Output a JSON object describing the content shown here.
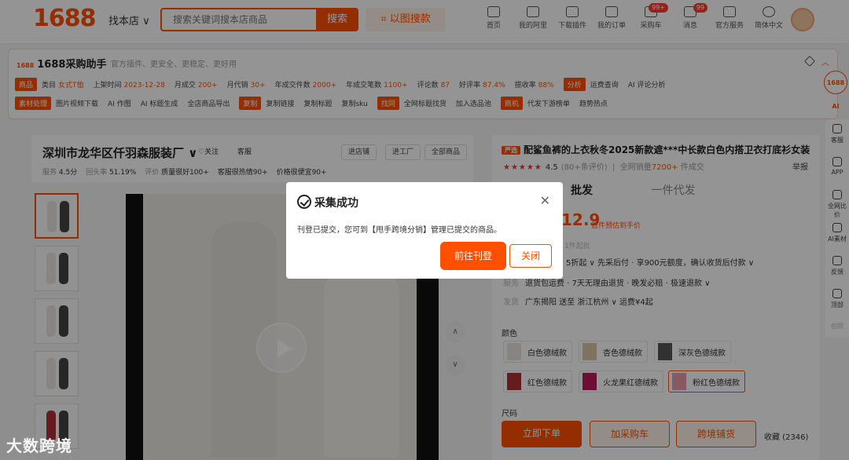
{
  "header": {
    "logo": "1688",
    "store_find": "找本店 ∨",
    "search_placeholder": "搜索关键词搜本店商品",
    "search_btn": "搜索",
    "image_search": "⌗ 以图搜款",
    "nav": [
      {
        "label": "首页"
      },
      {
        "label": "我的阿里"
      },
      {
        "label": "下载插件"
      },
      {
        "label": "我的订单"
      },
      {
        "label": "采购车",
        "badge": "99+"
      },
      {
        "label": "消息",
        "badge": "99"
      },
      {
        "label": "官方服务"
      },
      {
        "label": "简体中文"
      }
    ]
  },
  "helper": {
    "logo_mark": "1688",
    "title": "1688采购助手",
    "subtitle": "官方插件、更安全、更稳定、更好用",
    "row1": {
      "tag": "商品",
      "items": [
        {
          "label": "类目",
          "value": "女式T恤"
        },
        {
          "label": "上架时间",
          "value": "2023-12-28"
        },
        {
          "label": "月成交",
          "value": "200+"
        },
        {
          "label": "月代销",
          "value": "30+"
        },
        {
          "label": "年成交件数",
          "value": "2000+"
        },
        {
          "label": "年成交笔数",
          "value": "1100+"
        },
        {
          "label": "评论数",
          "value": "87"
        },
        {
          "label": "好评率",
          "value": "87.4%"
        },
        {
          "label": "揽收率",
          "value": "88%"
        }
      ],
      "tag2": "分析",
      "analysis": [
        "运费查询",
        "AI 评论分析"
      ]
    },
    "row2": {
      "tag": "素材处理",
      "items": [
        "图片视频下载",
        "AI 作图",
        "AI 标题生成",
        "全店商品导出"
      ],
      "tag_copy": "复制",
      "copy_items": [
        "复制链接",
        "复制标题",
        "复制sku"
      ],
      "tag_find": "找同",
      "find_items": [
        "全网标题找货",
        "加入选品池"
      ],
      "tag_biz": "商机",
      "biz_items": [
        "代发下游榜单",
        "趋势热点"
      ]
    }
  },
  "sidebar": {
    "ai_label": "1688 AI",
    "items": [
      "客服",
      "APP",
      "全网比价",
      "AI素材",
      "反馈",
      "顶部",
      "拍照"
    ]
  },
  "store": {
    "name": "深圳市龙华区仟羽森服装厂 ∨",
    "follow": "♡关注",
    "service": "客服",
    "buttons": [
      "进店铺",
      "进工厂",
      "全部商品"
    ],
    "stats": [
      {
        "label": "服务",
        "value": "4.5分"
      },
      {
        "label": "回头率",
        "value": "51.19%"
      },
      {
        "label": "评价",
        "value": "质量很好100+"
      },
      {
        "label": "",
        "value": "客服很热情90+"
      },
      {
        "label": "",
        "value": "价格很便宜90+"
      }
    ]
  },
  "product": {
    "badge": "严选",
    "title": "配鲨鱼裤的上衣秋冬2025新款遮***中长款白色内搭卫衣打底衫女装",
    "stars": "★★★★★",
    "rating": "4.5",
    "reviews": "(80+条评价)",
    "sales_label": "全网销量",
    "sales": "7200+",
    "sales_unit": "件成交",
    "report": "举报",
    "tab_wholesale": "批发",
    "tab_dropship": "一件代发",
    "price": "12.9",
    "price_note": "首件预估到手价",
    "min_order": "1件起批",
    "finance": "5折起 ∨   先采后付 · 享900元额度，确认收货后付款 ∨",
    "guarantee_label": "服务",
    "guarantee": "退货包运费 · 7天无理由退货 · 晚发必赔 · 极速退款 ∨",
    "ship_label": "发货",
    "ship": "广东揭阳 送至 浙江杭州 ∨  运费¥4起",
    "color_label": "颜色",
    "colors": [
      {
        "name": "白色德绒款",
        "swatch": "#e8e4de"
      },
      {
        "name": "杏色德绒款",
        "swatch": "#d9c6a8"
      },
      {
        "name": "深灰色德绒款",
        "swatch": "#555555"
      },
      {
        "name": "红色德绒款",
        "swatch": "#b0303a"
      },
      {
        "name": "火龙果红德绒款",
        "swatch": "#c2185b"
      },
      {
        "name": "粉红色德绒款",
        "swatch": "#e89aa8"
      }
    ],
    "size_label": "尺码",
    "buy_now": "立即下单",
    "add_cart": "加采购车",
    "cross_border": "跨境铺货",
    "favorite": "收藏 (2346)"
  },
  "modal": {
    "title": "采集成功",
    "message": "刊登已提交，您可到【甩手跨境分销】管理已提交的商品。",
    "primary": "前往刊登",
    "secondary": "关闭"
  },
  "watermark": "大数跨境",
  "colors": {
    "accent": "#ff5000"
  }
}
